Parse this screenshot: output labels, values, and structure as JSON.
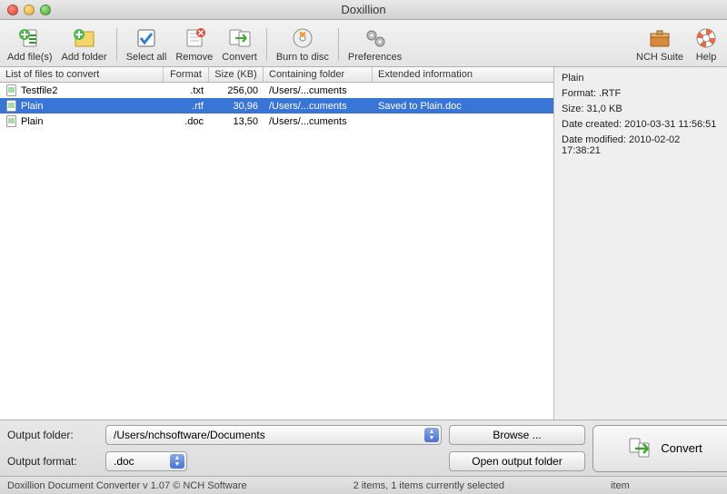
{
  "window": {
    "title": "Doxillion"
  },
  "toolbar": {
    "add_files": "Add file(s)",
    "add_folder": "Add folder",
    "select_all": "Select all",
    "remove": "Remove",
    "convert": "Convert",
    "burn": "Burn to disc",
    "preferences": "Preferences",
    "nch_suite": "NCH Suite",
    "help": "Help"
  },
  "list": {
    "headers": {
      "name": "List of files to convert",
      "format": "Format",
      "size": "Size (KB)",
      "folder": "Containing folder",
      "ext": "Extended information"
    },
    "rows": [
      {
        "name": "Testfile2",
        "format": ".txt",
        "size": "256,00",
        "folder": "/Users/...cuments",
        "ext": "",
        "selected": false
      },
      {
        "name": "Plain",
        "format": ".rtf",
        "size": "30,96",
        "folder": "/Users/...cuments",
        "ext": "Saved to Plain.doc",
        "selected": true
      },
      {
        "name": "Plain",
        "format": ".doc",
        "size": "13,50",
        "folder": "/Users/...cuments",
        "ext": "",
        "selected": false
      }
    ]
  },
  "info": {
    "title": "Plain",
    "format": "Format: .RTF",
    "size": "Size: 31,0 KB",
    "created": "Date created: 2010-03-31 11:56:51",
    "modified": "Date modified: 2010-02-02 17:38:21"
  },
  "bottom": {
    "output_folder_label": "Output folder:",
    "output_folder": "/Users/nchsoftware/Documents",
    "output_format_label": "Output format:",
    "output_format": ".doc",
    "browse": "Browse ...",
    "open_output": "Open output folder",
    "convert": "Convert"
  },
  "status": {
    "left": "Doxillion Document Converter v 1.07 © NCH Software",
    "center": "2 items, 1 items currently selected",
    "right": "item"
  }
}
